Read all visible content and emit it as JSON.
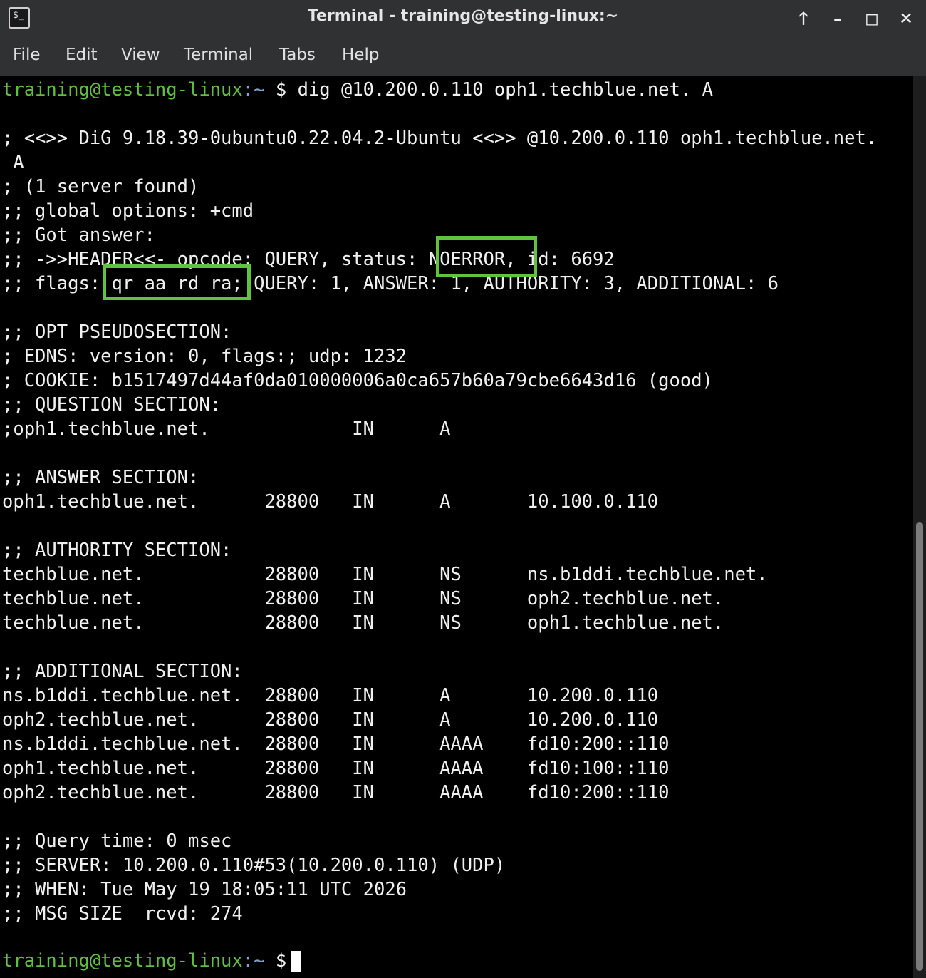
{
  "window": {
    "title": "Terminal - training@testing-linux:~",
    "icon_text": "$_",
    "icon_name": "terminal-icon",
    "buttons": {
      "up": "🡑",
      "minimize": "–",
      "maximize": "◻",
      "close": "✕"
    }
  },
  "menu": [
    "File",
    "Edit",
    "View",
    "Terminal",
    "Tabs",
    "Help"
  ],
  "prompt": {
    "user_host": "training@testing-linux",
    "path": ":~",
    "symbol": "$"
  },
  "command": "dig @10.200.0.110 oph1.techblue.net. A",
  "output": [
    "; <<>> DiG 9.18.39-0ubuntu0.22.04.2-Ubuntu <<>> @10.200.0.110 oph1.techblue.net.",
    " A",
    "; (1 server found)",
    ";; global options: +cmd",
    ";; Got answer:",
    ";; ->>HEADER<<- opcode: QUERY, status: NOERROR, id: 6692",
    ";; flags: qr aa rd ra; QUERY: 1, ANSWER: 1, AUTHORITY: 3, ADDITIONAL: 6",
    "",
    ";; OPT PSEUDOSECTION:",
    "; EDNS: version: 0, flags:; udp: 1232",
    "; COOKIE: b1517497d44af0da010000006a0ca657b60a79cbe6643d16 (good)",
    ";; QUESTION SECTION:",
    ";oph1.techblue.net.             IN      A",
    "",
    ";; ANSWER SECTION:",
    "oph1.techblue.net.      28800   IN      A       10.100.0.110",
    "",
    ";; AUTHORITY SECTION:",
    "techblue.net.           28800   IN      NS      ns.b1ddi.techblue.net.",
    "techblue.net.           28800   IN      NS      oph2.techblue.net.",
    "techblue.net.           28800   IN      NS      oph1.techblue.net.",
    "",
    ";; ADDITIONAL SECTION:",
    "ns.b1ddi.techblue.net.  28800   IN      A       10.200.0.110",
    "oph2.techblue.net.      28800   IN      A       10.200.0.110",
    "ns.b1ddi.techblue.net.  28800   IN      AAAA    fd10:200::110",
    "oph1.techblue.net.      28800   IN      AAAA    fd10:100::110",
    "oph2.techblue.net.      28800   IN      AAAA    fd10:200::110",
    "",
    ";; Query time: 0 msec",
    ";; SERVER: 10.200.0.110#53(10.200.0.110) (UDP)",
    ";; WHEN: Tue May 19 18:05:11 UTC 2026",
    ";; MSG SIZE  rcvd: 274",
    ""
  ],
  "highlights": [
    "NOERROR",
    "qr aa rd ra"
  ],
  "colors": {
    "prompt_green": "#5fbf3f",
    "highlight_green": "#5ec43d",
    "terminal_bg": "#000000",
    "text": "#f0f0f0"
  }
}
